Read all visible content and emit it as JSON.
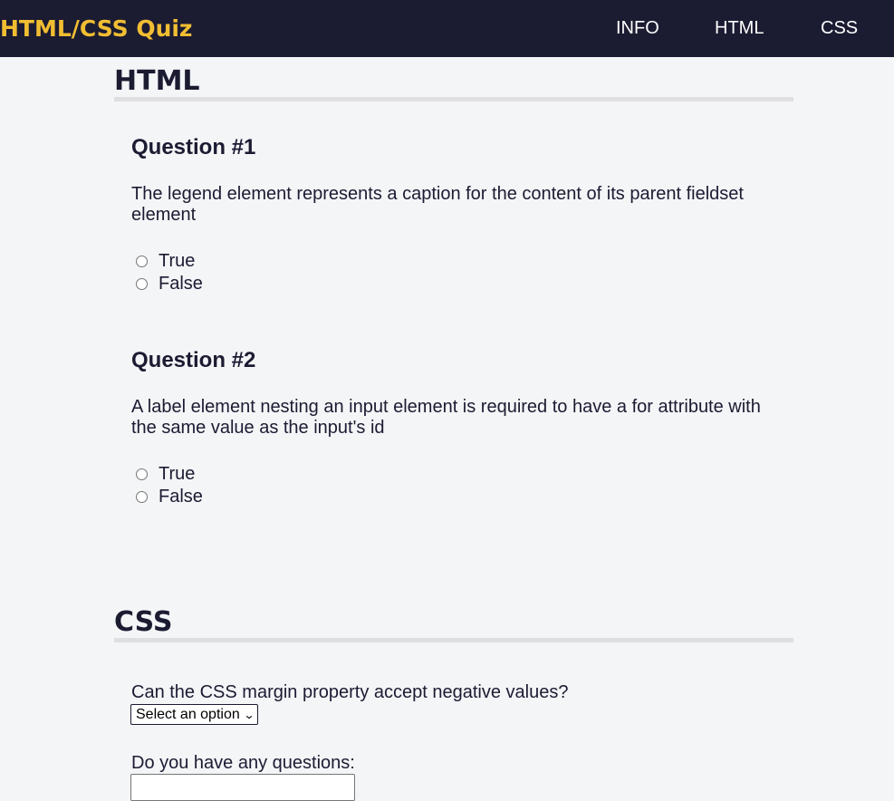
{
  "header": {
    "brand": "HTML/CSS Quiz",
    "nav": [
      {
        "label": "INFO"
      },
      {
        "label": "HTML"
      },
      {
        "label": "CSS"
      }
    ]
  },
  "sections": [
    {
      "title": "HTML",
      "questions": [
        {
          "heading": "Question #1",
          "text": "The legend element represents a caption for the content of its parent fieldset element",
          "options": [
            "True",
            "False"
          ]
        },
        {
          "heading": "Question #2",
          "text": "A label element nesting an input element is required to have a for attribute with the same value as the input's id",
          "options": [
            "True",
            "False"
          ]
        }
      ]
    },
    {
      "title": "CSS",
      "select_question": "Can the CSS margin property accept negative values?",
      "select_value": "Select an option",
      "questions_label": "Do you have any questions:",
      "questions_input_value": ""
    }
  ]
}
